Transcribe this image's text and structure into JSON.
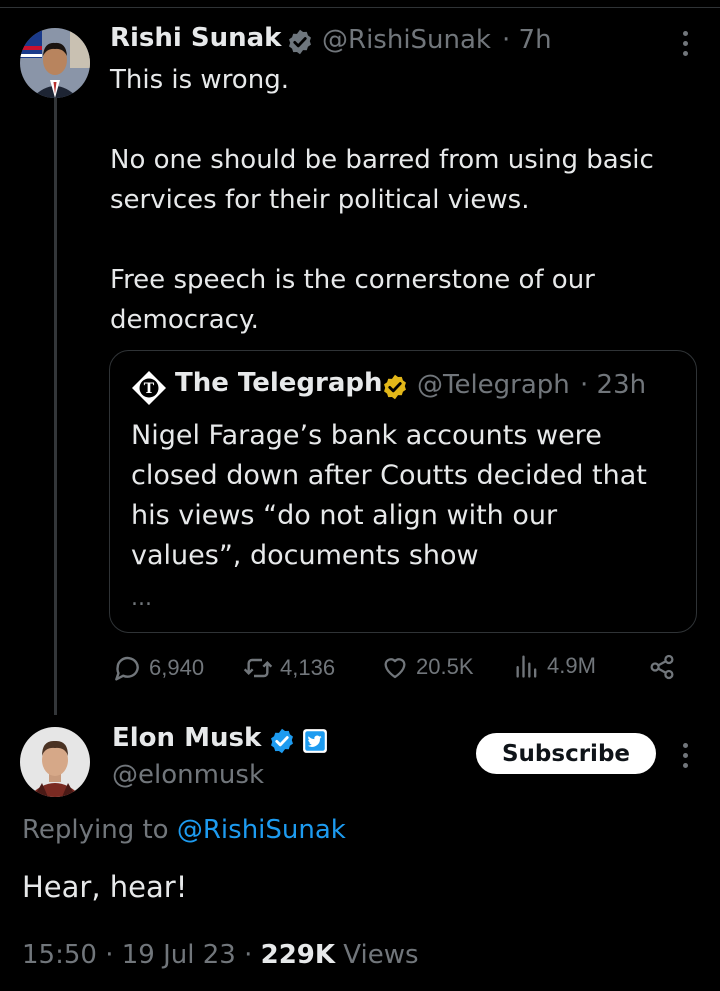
{
  "colors": {
    "background": "#000000",
    "text": "#e7e9ea",
    "muted": "#71767b",
    "link": "#1d9bf0",
    "verified_blue": "#1d9bf0",
    "verified_gold": "#e2b719"
  },
  "parent_tweet": {
    "name": "Rishi Sunak",
    "handle": "@RishiSunak",
    "time": "· 7h",
    "line1": "This is wrong.",
    "line2": "No one should be barred from using basic services for their political views.",
    "line3": "Free speech is the cornerstone of our democracy.",
    "quote": {
      "name": "The Telegraph",
      "handle": "@Telegraph",
      "time": "· 23h",
      "text": "Nigel Farage’s bank accounts were closed down after Coutts decided that his views “do not align with our values”, documents show",
      "more": "..."
    },
    "actions": {
      "replies": "6,940",
      "reposts": "4,136",
      "likes": "20.5K",
      "views": "4.9M"
    }
  },
  "main_tweet": {
    "name": "Elon Musk",
    "handle": "@elonmusk",
    "subscribe_label": "Subscribe",
    "replying_prefix": "Replying to",
    "replying_to": "@RishiSunak",
    "text": "Hear, hear!",
    "time": "15:50",
    "date": "19 Jul 23",
    "views_count": "229K",
    "views_label": "Views"
  }
}
